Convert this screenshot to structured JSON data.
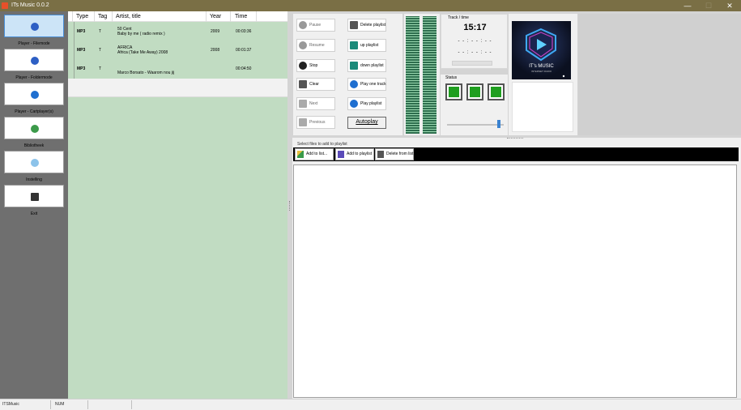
{
  "window": {
    "title": "ITs Music 0.0.2",
    "minimize": "—",
    "maximize": "☐",
    "close": "✕"
  },
  "sidebar": {
    "items": [
      {
        "label": "Player - Filemode",
        "active": true
      },
      {
        "label": "Player - Foldermode"
      },
      {
        "label": "Player - Cartplayer(s)"
      },
      {
        "label": "Bibliotheek"
      },
      {
        "label": "Instelling"
      },
      {
        "label": "Exit"
      }
    ]
  },
  "tracks": {
    "columns": [
      "Type",
      "Tag",
      "Artist, title",
      "Year",
      "Time"
    ],
    "rows": [
      {
        "type": "MP3",
        "tag": "T",
        "artist": "50 Cent",
        "title": "Baby by me ( radio remix )",
        "year": "2009",
        "time": "00:03:36"
      },
      {
        "type": "MP3",
        "tag": "T",
        "artist": "AFRICA",
        "title": "Africa (Take Me Away) 2008",
        "year": "2008",
        "time": "00:01:37"
      },
      {
        "type": "MP3",
        "tag": "T",
        "artist": "",
        "title": "Marco Borsato - Waarom nou jij",
        "year": "",
        "time": "00:04:50"
      }
    ]
  },
  "controls": {
    "pause": "Pause",
    "resume": "Resume",
    "stop": "Stop",
    "clear": "Clear",
    "next": "Next",
    "previous": "Previous",
    "delete_playlist": "Delete playlist",
    "up_playlist": "up playlist",
    "down_playlist": "down playlist",
    "play_one_track": "Play one track",
    "play_playlist": "Play playlist",
    "autoplay": "Autoplay"
  },
  "track_time": {
    "caption": "Track / time",
    "time": "15:17",
    "line1": "- - : - - : - -",
    "line2": "- - : - - : - -"
  },
  "status": {
    "caption": "Status"
  },
  "volume": {
    "level": 0.92
  },
  "album_art": {
    "caption": "IT's MUSIC",
    "subcaption": "INTERNET RADIO"
  },
  "files": {
    "label": "Select files to add to playlist",
    "add_to_list": "Add to list...",
    "add_to_playlist": "Add to playlist",
    "delete_from_list": "Delete from list"
  },
  "statusbar": {
    "app": "ITSMusic",
    "num": "NUM"
  },
  "colors": {
    "titlebar": "#7a6f45",
    "sidebar": "#6f6f6f",
    "track_list": "#c1dcc2",
    "led": "#1f9e1f",
    "accent": "#3a82d0"
  }
}
